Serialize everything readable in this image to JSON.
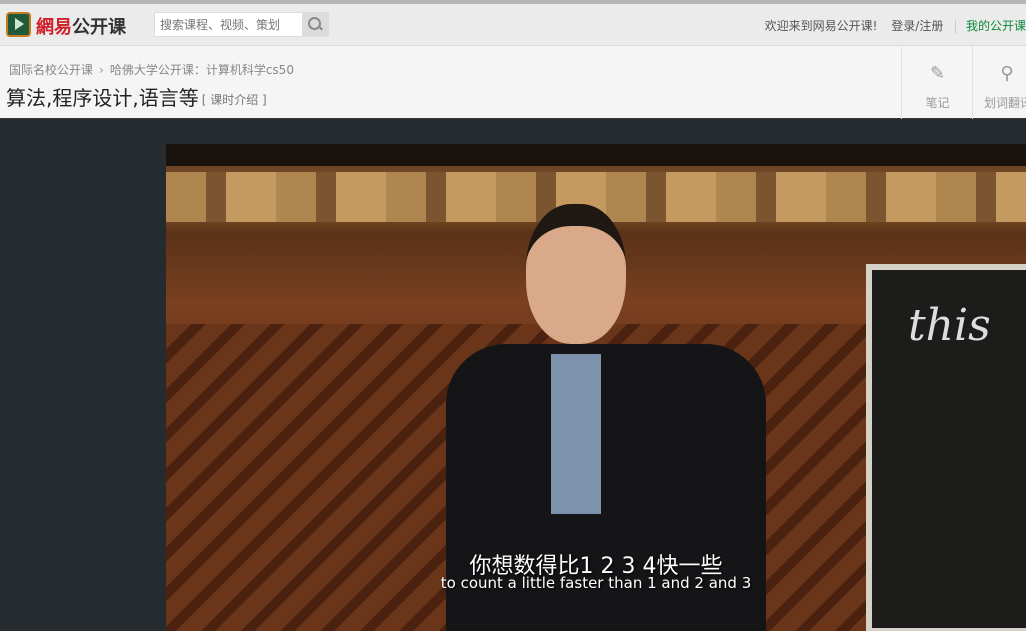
{
  "header": {
    "brand_red": "網易",
    "brand_black": "公开课",
    "search_placeholder": "搜索课程、视频、策划",
    "welcome": "欢迎来到网易公开课!",
    "login": "登录/注册",
    "my_courses": "我的公开课"
  },
  "breadcrumb": {
    "items": [
      "国际名校公开课",
      "哈佛大学公开课：计算机科学cs50"
    ]
  },
  "lesson": {
    "title": "算法,程序设计,语言等",
    "intro_link": "[ 课时介绍 ]"
  },
  "tools": [
    {
      "label": "笔记",
      "icon": "edit-icon"
    },
    {
      "label": "划词翻译",
      "icon": "translate-icon"
    }
  ],
  "video": {
    "board_text": "this",
    "subtitle_zh": "你想数得比1 2 3 4快一些",
    "subtitle_en": "to count a little faster than 1 and 2 and 3"
  },
  "colors": {
    "brand_red": "#d0202a",
    "green_link": "#0a8a36"
  }
}
